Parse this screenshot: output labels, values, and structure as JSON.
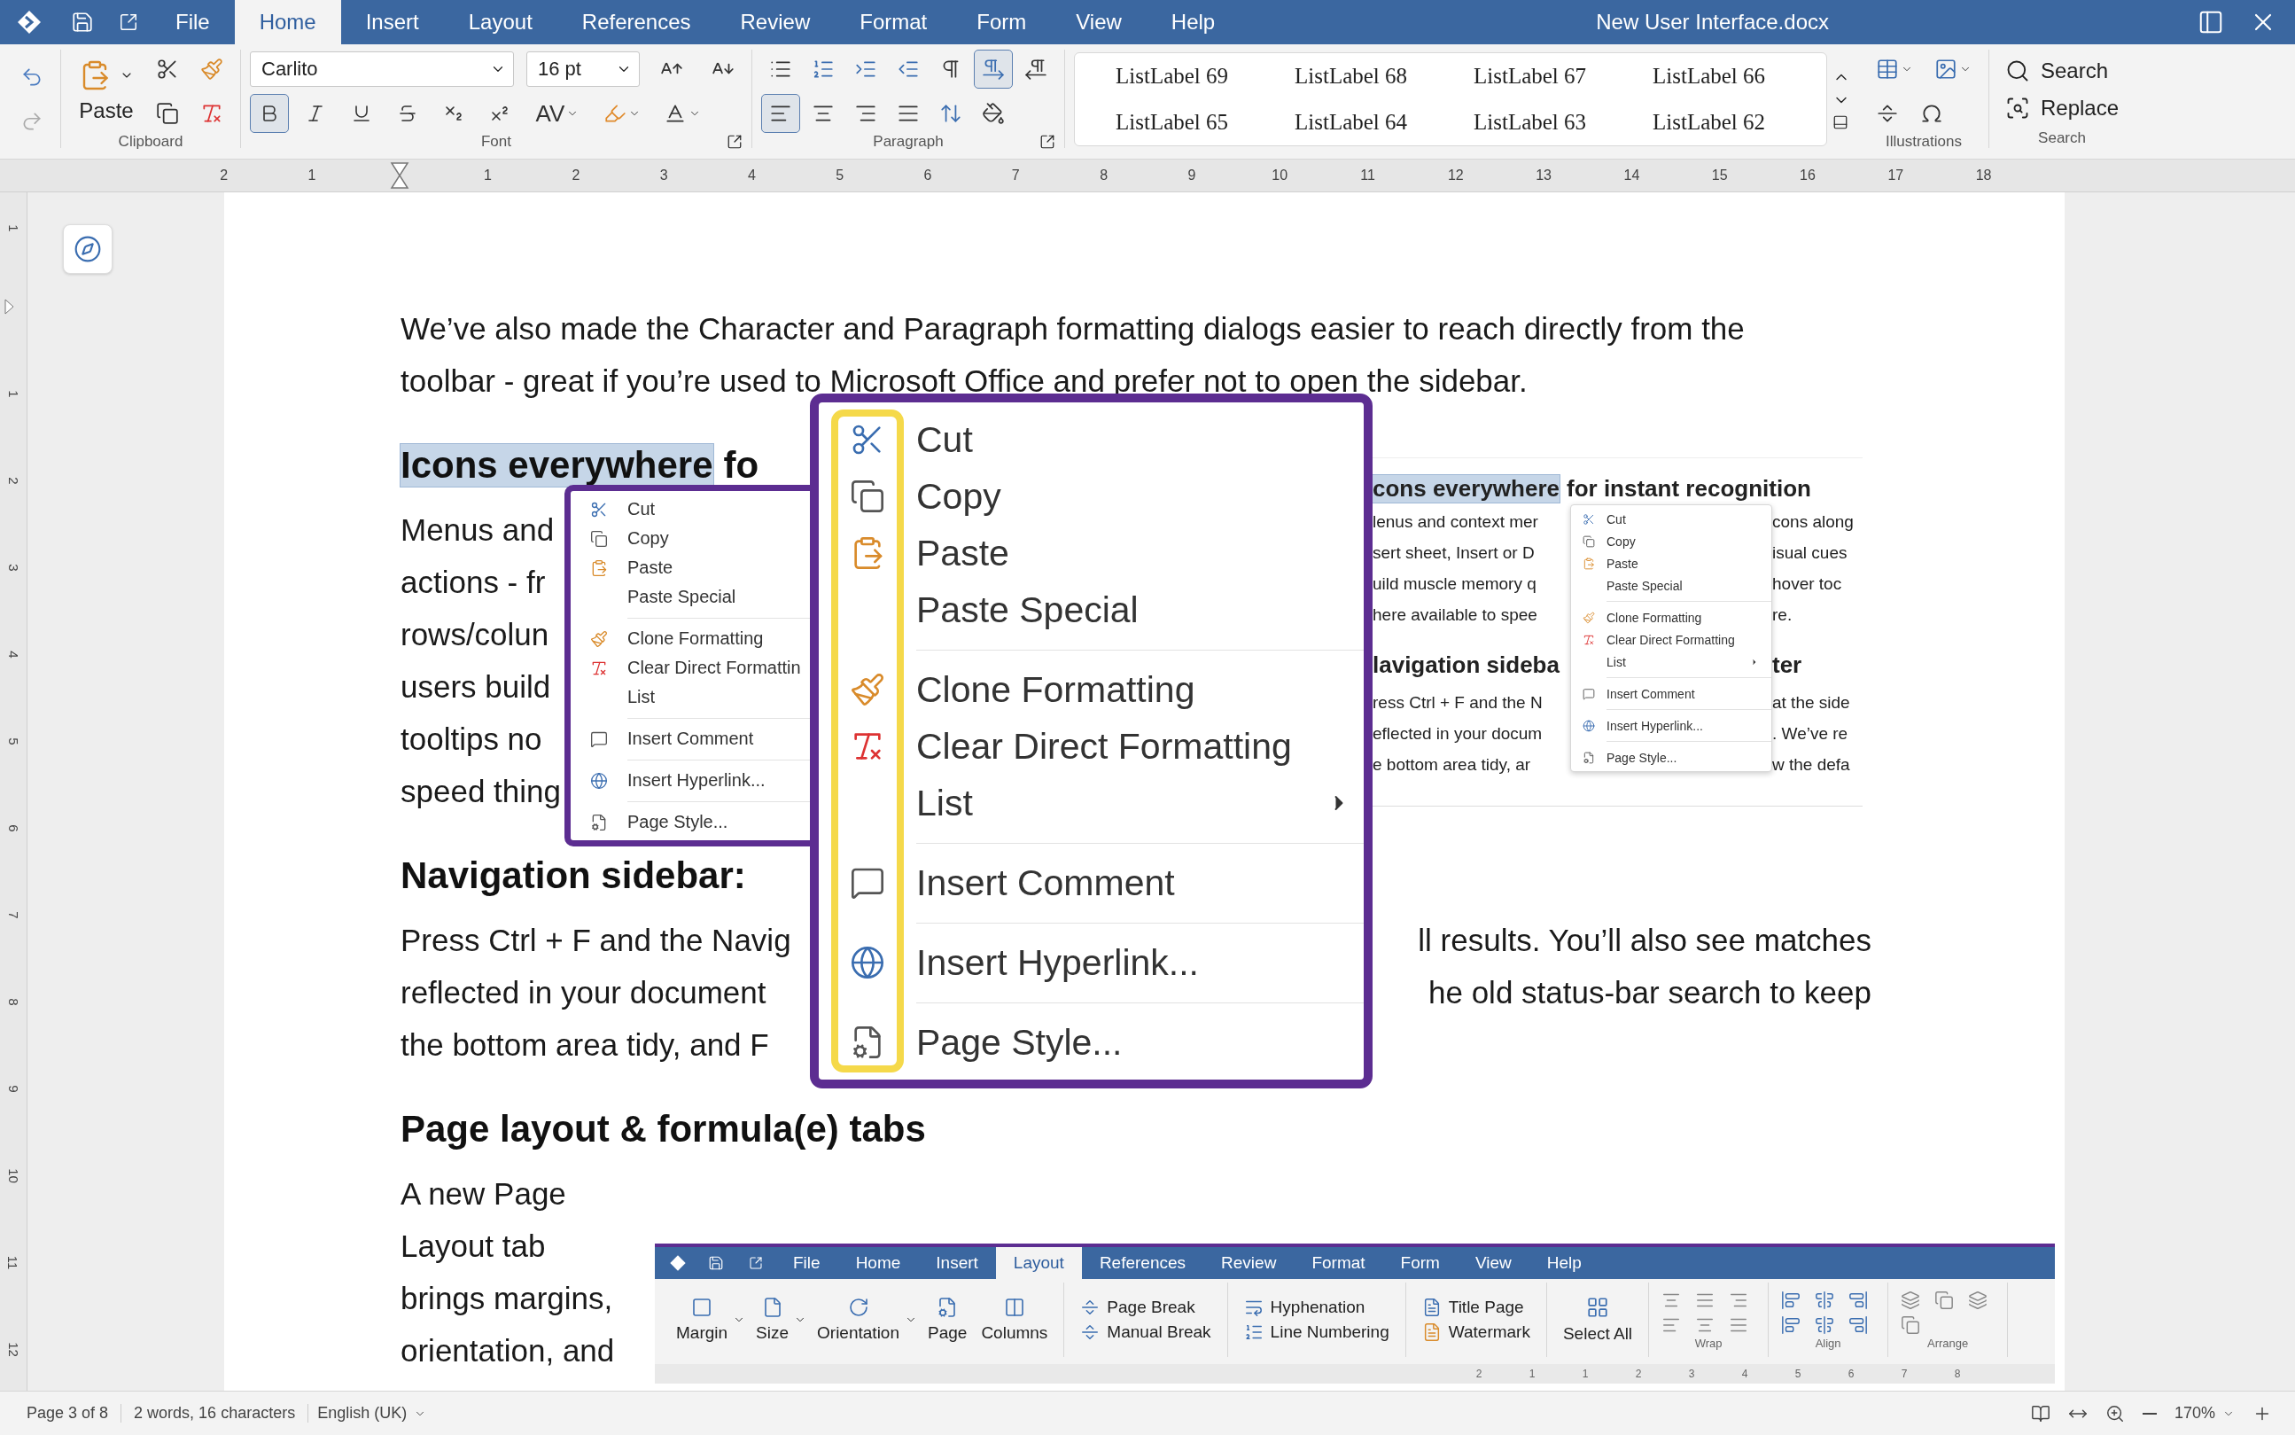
{
  "titlebar": {
    "title": "New User Interface.docx",
    "tabs": [
      {
        "label": "File",
        "selected": false
      },
      {
        "label": "Home",
        "selected": true
      },
      {
        "label": "Insert",
        "selected": false
      },
      {
        "label": "Layout",
        "selected": false
      },
      {
        "label": "References",
        "selected": false
      },
      {
        "label": "Review",
        "selected": false
      },
      {
        "label": "Format",
        "selected": false
      },
      {
        "label": "Form",
        "selected": false
      },
      {
        "label": "View",
        "selected": false
      },
      {
        "label": "Help",
        "selected": false
      }
    ]
  },
  "ribbon": {
    "clipboard": {
      "paste": "Paste",
      "label": "Clipboard"
    },
    "font": {
      "name": "Carlito",
      "size": "16 pt",
      "toggles": [
        {
          "selected": true
        },
        {
          "selected": false
        },
        {
          "selected": false
        },
        {
          "selected": false
        },
        {
          "selected": false
        },
        {
          "selected": false
        }
      ],
      "spacing": "AV",
      "label": "Font"
    },
    "paragraph": {
      "row1": [
        {
          "selected": false
        },
        {
          "selected": false
        },
        {
          "selected": false
        },
        {
          "selected": false
        },
        {
          "selected": false
        },
        {
          "selected": true
        },
        {
          "selected": false
        }
      ],
      "row2": [
        {
          "selected": true
        },
        {
          "selected": false
        },
        {
          "selected": false
        },
        {
          "selected": false
        },
        {
          "selected": false
        },
        {
          "selected": false
        }
      ],
      "label": "Paragraph"
    },
    "styles": [
      "ListLabel 69",
      "ListLabel 68",
      "ListLabel 67",
      "ListLabel 66",
      "ListLabel 65",
      "ListLabel 64",
      "ListLabel 63",
      "ListLabel 62"
    ],
    "illustrations": {
      "label": "Illustrations"
    },
    "search": {
      "search": "Search",
      "replace": "Replace",
      "label": "Search"
    }
  },
  "ruler": {
    "left_numbers": [
      "2",
      "1"
    ],
    "numbers": [
      "1",
      "2",
      "3",
      "4",
      "5",
      "6",
      "7",
      "8",
      "9",
      "10",
      "11",
      "12",
      "13",
      "14",
      "15",
      "16",
      "17",
      "18"
    ]
  },
  "vertical_ruler": {
    "top_numbers": [
      "1"
    ],
    "numbers": [
      "1",
      "2",
      "3",
      "4",
      "5",
      "6",
      "7",
      "8",
      "9",
      "10",
      "11",
      "12"
    ]
  },
  "document": {
    "blocks": [
      {
        "kind": "paragraph",
        "lines": [
          {
            "left": "We’ve also made the Character and Paragraph formatting dialogs easier to reach directly from the"
          },
          {
            "left": "toolbar - great if you’re used to Microsoft Office and prefer not to open the sidebar."
          }
        ]
      },
      {
        "kind": "heading",
        "segments": [
          {
            "text": "Icons everywhere",
            "highlighted": true
          },
          {
            "text": "fo",
            "highlighted": false
          }
        ]
      },
      {
        "kind": "paragraph",
        "lines": [
          {
            "left": "Menus and"
          },
          {
            "left": "actions - fr"
          },
          {
            "left": "rows/colun"
          },
          {
            "left": "users build"
          },
          {
            "left": "tooltips no"
          },
          {
            "left": "speed thing"
          }
        ]
      },
      {
        "kind": "heading",
        "segments": [
          {
            "text": "Navigation sidebar:",
            "highlighted": false
          }
        ]
      },
      {
        "kind": "paragraph",
        "lines": [
          {
            "left": "Press Ctrl + F and the Navig",
            "right": "ll results. You’ll also see matches"
          },
          {
            "left": "reflected in your document",
            "right": "he old status-bar search to keep"
          },
          {
            "left": "the bottom area tidy, and F"
          }
        ]
      },
      {
        "kind": "heading",
        "segments": [
          {
            "text": "Page layout & formula(e) tabs",
            "highlighted": false
          }
        ]
      },
      {
        "kind": "paragraph",
        "lines": [
          {
            "left": "A new Page"
          },
          {
            "left": "Layout tab"
          },
          {
            "left": "brings margins,"
          },
          {
            "left": "orientation, and"
          }
        ]
      }
    ]
  },
  "small_menu": {
    "items": [
      {
        "kind": "item",
        "label": "Cut"
      },
      {
        "kind": "item",
        "label": "Copy"
      },
      {
        "kind": "item",
        "label": "Paste"
      },
      {
        "kind": "item",
        "label": "Paste Special"
      },
      {
        "kind": "separator"
      },
      {
        "kind": "item",
        "label": "Clone Formatting"
      },
      {
        "kind": "item",
        "label": "Clear Direct Formattin"
      },
      {
        "kind": "item",
        "label": "List"
      },
      {
        "kind": "separator"
      },
      {
        "kind": "item",
        "label": "Insert Comment"
      },
      {
        "kind": "separator"
      },
      {
        "kind": "item",
        "label": "Insert Hyperlink..."
      },
      {
        "kind": "separator"
      },
      {
        "kind": "item",
        "label": "Page Style..."
      }
    ]
  },
  "big_menu": {
    "items": [
      {
        "kind": "item",
        "label": "Cut"
      },
      {
        "kind": "item",
        "label": "Copy"
      },
      {
        "kind": "item",
        "label": "Paste"
      },
      {
        "kind": "item",
        "label": "Paste Special"
      },
      {
        "kind": "separator"
      },
      {
        "kind": "item",
        "label": "Clone Formatting"
      },
      {
        "kind": "item",
        "label": "Clear Direct Formatting"
      },
      {
        "kind": "item",
        "label": "List",
        "submenu": true
      },
      {
        "kind": "separator"
      },
      {
        "kind": "item",
        "label": "Insert Comment"
      },
      {
        "kind": "separator"
      },
      {
        "kind": "item",
        "label": "Insert Hyperlink..."
      },
      {
        "kind": "separator"
      },
      {
        "kind": "item",
        "label": "Page Style..."
      }
    ]
  },
  "inset": {
    "heading": [
      {
        "text": "cons everywhere",
        "highlighted": true
      },
      {
        "text": "for instant recognition",
        "highlighted": false
      }
    ],
    "lines": [
      {
        "left": "lenus and context mer",
        "right": "cons along"
      },
      {
        "left": "sert sheet, Insert or D",
        "right": "isual cues"
      },
      {
        "left": "uild muscle memory q",
        "right": "hover toc"
      },
      {
        "left": "here available to spee",
        "right": "re."
      }
    ],
    "heading2": {
      "left": "lavigation sideba",
      "right": "ter"
    },
    "lines2": [
      {
        "left": "ress Ctrl + F and the N",
        "right": "at the side"
      },
      {
        "left": "eflected in your docum",
        "right": ". We’ve re"
      },
      {
        "left": "e bottom area tidy, ar",
        "right": "w the defa"
      }
    ],
    "menu": {
      "items": [
        {
          "kind": "item",
          "label": "Cut"
        },
        {
          "kind": "item",
          "label": "Copy"
        },
        {
          "kind": "item",
          "label": "Paste"
        },
        {
          "kind": "item",
          "label": "Paste Special"
        },
        {
          "kind": "separator"
        },
        {
          "kind": "item",
          "label": "Clone Formatting"
        },
        {
          "kind": "item",
          "label": "Clear Direct Formatting"
        },
        {
          "kind": "item",
          "label": "List",
          "submenu": true
        },
        {
          "kind": "separator"
        },
        {
          "kind": "item",
          "label": "Insert Comment"
        },
        {
          "kind": "separator"
        },
        {
          "kind": "item",
          "label": "Insert Hyperlink..."
        },
        {
          "kind": "separator"
        },
        {
          "kind": "item",
          "label": "Page Style..."
        }
      ]
    }
  },
  "layout_inset": {
    "tabs": [
      {
        "label": "File",
        "selected": false
      },
      {
        "label": "Home",
        "selected": false
      },
      {
        "label": "Insert",
        "selected": false
      },
      {
        "label": "Layout",
        "selected": true
      },
      {
        "label": "References",
        "selected": false
      },
      {
        "label": "Review",
        "selected": false
      },
      {
        "label": "Format",
        "selected": false
      },
      {
        "label": "Form",
        "selected": false
      },
      {
        "label": "View",
        "selected": false
      },
      {
        "label": "Help",
        "selected": false
      }
    ],
    "big_buttons": [
      {
        "label": "Margin",
        "dropdown": true
      },
      {
        "label": "Size",
        "dropdown": true
      },
      {
        "label": "Orientation",
        "dropdown": true
      },
      {
        "label": "Page"
      },
      {
        "label": "Columns"
      }
    ],
    "pairs": [
      [
        "Page Break",
        "Manual Break"
      ],
      [
        "Hyphenation",
        "Line Numbering"
      ],
      [
        "Title Page",
        "Watermark"
      ]
    ],
    "select_all": "Select All",
    "groups": [
      "Wrap",
      "Align",
      "Arrange"
    ],
    "ruler_numbers": [
      "2",
      "1",
      "1",
      "2",
      "3",
      "4",
      "5",
      "6",
      "7",
      "8"
    ]
  },
  "status_bar": {
    "page": "Page 3 of 8",
    "words": "2 words, 16 characters",
    "language": "English (UK)",
    "zoom": "170%"
  }
}
